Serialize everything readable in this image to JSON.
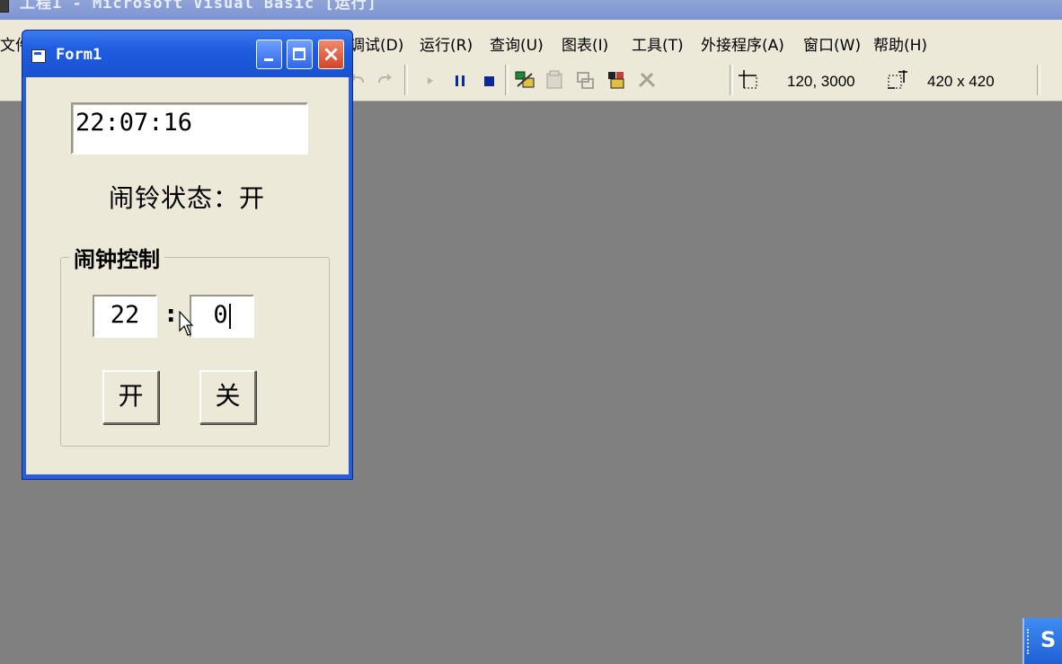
{
  "ide": {
    "title": "工程1 - Microsoft Visual Basic [运行]",
    "menu": [
      "文件",
      "调试(D)",
      "运行(R)",
      "查询(U)",
      "图表(I)",
      "工具(T)",
      "外接程序(A)",
      "窗口(W)",
      "帮助(H)"
    ],
    "toolbar": {
      "position_readout": "120, 3000",
      "size_readout": "420 x 420"
    }
  },
  "form": {
    "title": "Form1",
    "time_display": "22:07:16",
    "alarm_status": "闹铃状态：开",
    "group_label": "闹钟控制",
    "hour_value": "22",
    "minute_value": "0",
    "colon": ":",
    "on_button": "开",
    "off_button": "关"
  },
  "taskbar": {
    "corner_glyph": "S"
  }
}
